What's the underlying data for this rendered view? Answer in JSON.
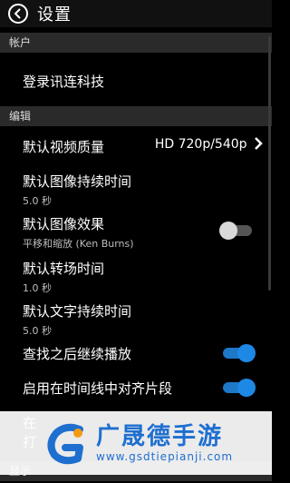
{
  "header": {
    "title": "设置"
  },
  "sections": {
    "account": "帐户",
    "edit": "编辑",
    "display": "显示"
  },
  "account": {
    "login_label": "登录讯连科技"
  },
  "edit": {
    "video_quality": {
      "label": "默认视频质量",
      "value": "HD 720p/540p"
    },
    "image_duration": {
      "label": "默认图像持续时间",
      "value": "5.0  秒"
    },
    "image_effect": {
      "label": "默认图像效果",
      "value": "平移和缩放 (Ken Burns)",
      "enabled": false
    },
    "transition_time": {
      "label": "默认转场时间",
      "value": "1.0  秒"
    },
    "text_duration": {
      "label": "默认文字持续时间",
      "value": "5.0  秒"
    },
    "continue_after_seek": {
      "label": "查找之后继续播放",
      "enabled": true
    },
    "snap_on_timeline": {
      "label": "启用在时间线中对齐片段",
      "enabled": true
    },
    "partial_row": {
      "line1": "在",
      "line2": "打"
    }
  },
  "watermark": {
    "title": "广晟德手游",
    "url": "www.gsdtiepianji.com"
  },
  "colors": {
    "accent": "#1e88e5",
    "section_bg": "#2a2a2a",
    "background": "#000000"
  }
}
